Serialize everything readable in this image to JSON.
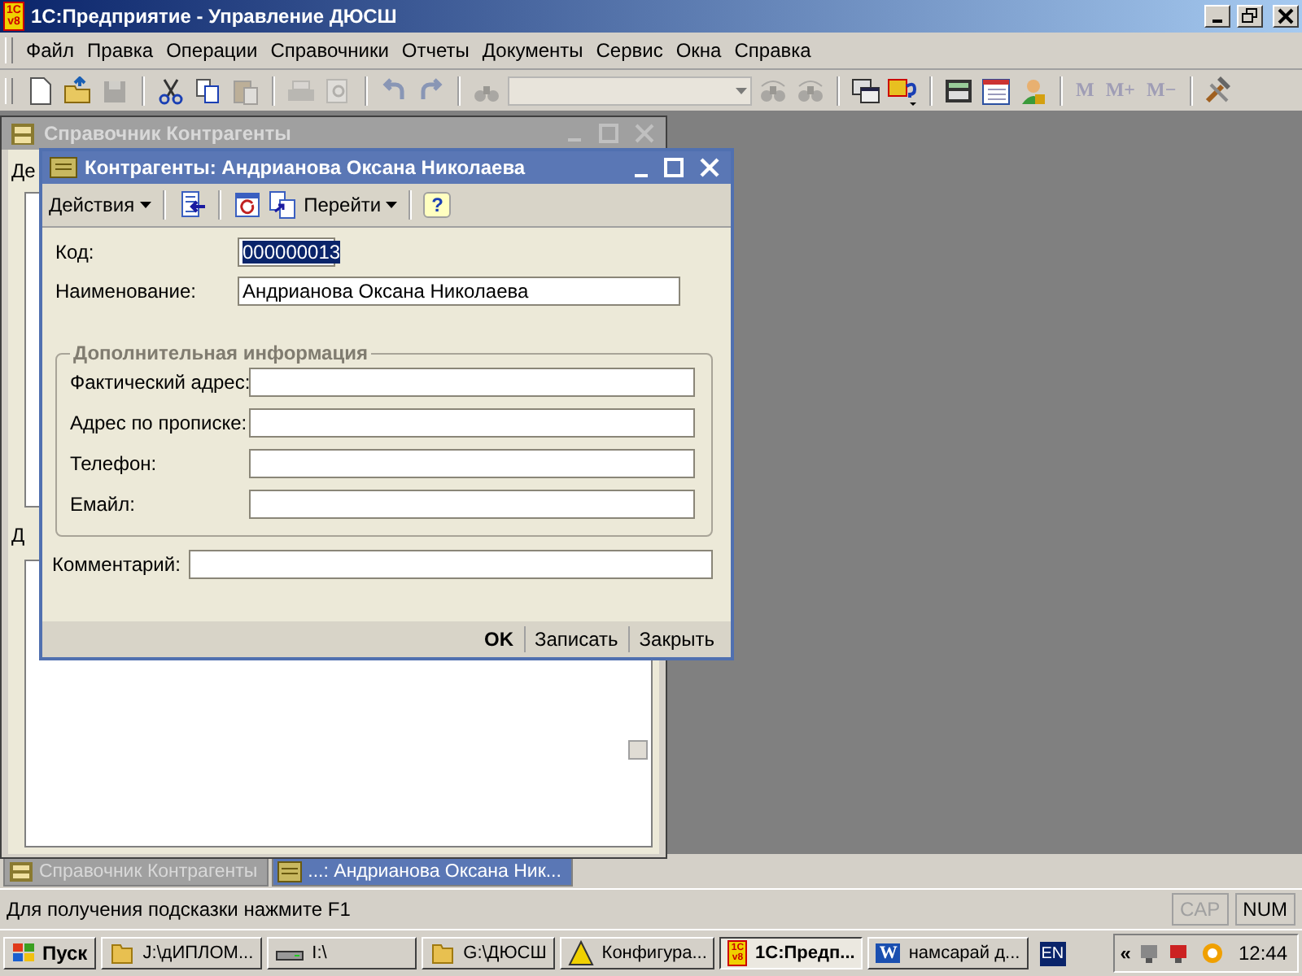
{
  "window": {
    "title": "1С:Предприятие - Управление ДЮСШ",
    "badge_top": "1С",
    "badge_bottom": "v8"
  },
  "menu": [
    "Файл",
    "Правка",
    "Операции",
    "Справочники",
    "Отчеты",
    "Документы",
    "Сервис",
    "Окна",
    "Справка"
  ],
  "toolbar": [
    {
      "kind": "new",
      "disabled": false
    },
    {
      "kind": "open",
      "disabled": false
    },
    {
      "kind": "save",
      "disabled": true
    },
    {
      "kind": "sep"
    },
    {
      "kind": "cut",
      "disabled": false
    },
    {
      "kind": "copy",
      "disabled": false
    },
    {
      "kind": "paste",
      "disabled": true
    },
    {
      "kind": "sep"
    },
    {
      "kind": "print",
      "disabled": true
    },
    {
      "kind": "preview",
      "disabled": true
    },
    {
      "kind": "sep"
    },
    {
      "kind": "undo",
      "disabled": true
    },
    {
      "kind": "redo",
      "disabled": true
    },
    {
      "kind": "sep"
    },
    {
      "kind": "find",
      "disabled": true
    },
    {
      "kind": "combo",
      "disabled": true
    },
    {
      "kind": "findnext",
      "disabled": true
    },
    {
      "kind": "findprev",
      "disabled": true
    },
    {
      "kind": "sep"
    },
    {
      "kind": "windows",
      "disabled": false
    },
    {
      "kind": "helpmenu",
      "disabled": false
    },
    {
      "kind": "sep"
    },
    {
      "kind": "calculator",
      "disabled": false
    },
    {
      "kind": "calendar",
      "disabled": false
    },
    {
      "kind": "user",
      "disabled": false
    },
    {
      "kind": "sep"
    },
    {
      "kind": "text",
      "label": "M",
      "disabled": true
    },
    {
      "kind": "text",
      "label": "M+",
      "disabled": true
    },
    {
      "kind": "text",
      "label": "M−",
      "disabled": true
    },
    {
      "kind": "sep"
    },
    {
      "kind": "tools",
      "disabled": false
    }
  ],
  "back_window": {
    "title": "Справочник Контрагенты",
    "active": false,
    "partial_texts": [
      "Де",
      "Д"
    ]
  },
  "dialog": {
    "title": "Контрагенты: Андрианова Оксана Николаева",
    "active": true,
    "toolbar": [
      {
        "kind": "dropdown",
        "label": "Действия"
      },
      {
        "kind": "sep"
      },
      {
        "kind": "listarrow"
      },
      {
        "kind": "sep"
      },
      {
        "kind": "refresh"
      },
      {
        "kind": "copyarrow"
      },
      {
        "kind": "dropdown",
        "label": "Перейти"
      },
      {
        "kind": "sep"
      },
      {
        "kind": "help",
        "label": "?"
      }
    ],
    "code": {
      "label": "Код:",
      "value": "000000013",
      "selected": true
    },
    "name": {
      "label": "Наименование:",
      "value": "Андрианова Оксана Николаева"
    },
    "group": {
      "title": "Дополнительная информация",
      "fields": [
        {
          "label": "Фактический адрес:"
        },
        {
          "label": "Адрес по прописке:"
        },
        {
          "label": "Телефон:"
        },
        {
          "label": "Емайл:"
        }
      ]
    },
    "comment": {
      "label": "Комментарий:"
    },
    "buttons": [
      {
        "label": "OK",
        "default": true
      },
      {
        "label": "Записать",
        "default": false
      },
      {
        "label": "Закрыть",
        "default": false
      }
    ]
  },
  "window_tabs": [
    {
      "kind": "catalog",
      "label": "Справочник Контрагенты",
      "selected": false
    },
    {
      "kind": "form",
      "label": "...: Андрианова Оксана Ник...",
      "selected": true
    }
  ],
  "status_bar": {
    "hint": "Для получения подсказки нажмите F1",
    "indicators": [
      {
        "label": "CAP",
        "disabled": true
      },
      {
        "label": "NUM",
        "disabled": false
      }
    ]
  },
  "taskbar": {
    "start": "Пуск",
    "items": [
      {
        "kind": "folder",
        "label": "J:\\дИПЛОМ...",
        "selected": false
      },
      {
        "kind": "drive",
        "label": "I:\\",
        "selected": false
      },
      {
        "kind": "folder",
        "label": "G:\\ДЮСШ",
        "selected": false
      },
      {
        "kind": "config",
        "label": "Конфигура...",
        "selected": false
      },
      {
        "kind": "app",
        "label": "1С:Предп...",
        "selected": true,
        "badge_top": "1С",
        "badge_bottom": "v8"
      },
      {
        "kind": "word",
        "label": "намсарай д...",
        "selected": false,
        "badge": "W"
      }
    ],
    "lang": "EN",
    "tray_toggle": "«",
    "clock": "12:44"
  }
}
